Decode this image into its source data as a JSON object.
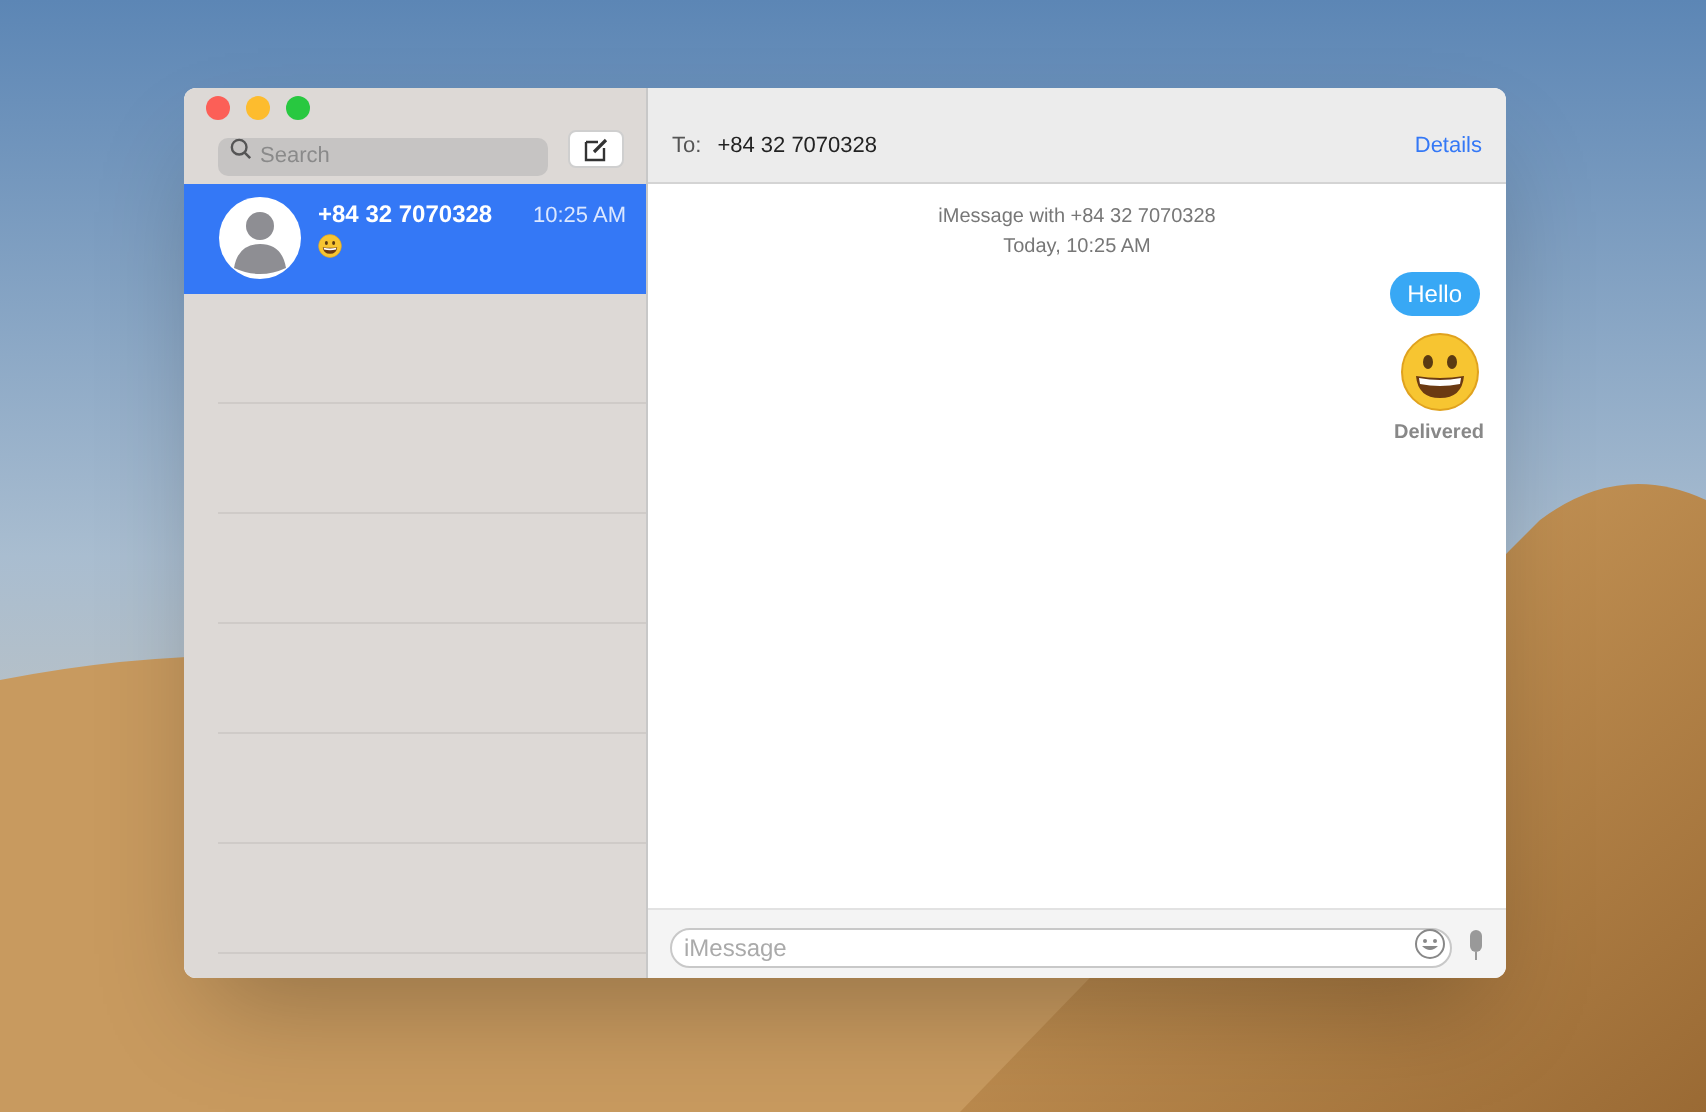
{
  "sidebar": {
    "search": {
      "placeholder": "Search"
    },
    "conversations": [
      {
        "name": "+84 32 7070328",
        "time": "10:25 AM",
        "preview": {
          "kind": "emoji"
        },
        "selected": true
      }
    ]
  },
  "header": {
    "to_label": "To:",
    "recipient": "+84 32 7070328",
    "details": "Details"
  },
  "chat": {
    "info": "iMessage with +84 32 7070328",
    "date": "Today, 10:25 AM",
    "messages": [
      {
        "kind": "text",
        "text": "Hello"
      },
      {
        "kind": "emoji"
      }
    ],
    "status": "Delivered"
  },
  "composer": {
    "placeholder": "iMessage"
  }
}
